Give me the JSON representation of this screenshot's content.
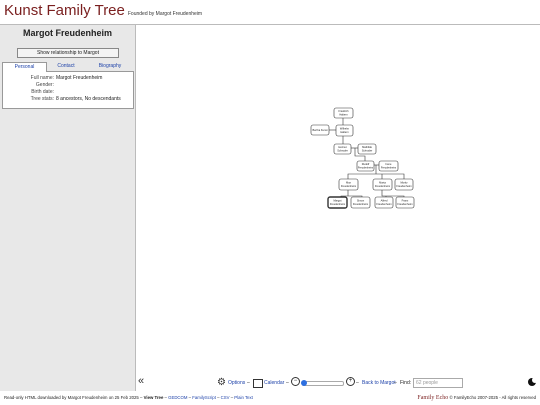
{
  "site": {
    "title": "Kunst Family Tree",
    "subtitle": "Founded by Margot Freudenheim",
    "brand_color": "#7a1f1f"
  },
  "sidebar": {
    "person_name": "Margot Freudenheim",
    "relationship_button": "Show relationship to Margot",
    "tabs": [
      "Personal",
      "Contact",
      "Biography"
    ],
    "active_tab": "Personal",
    "fields": [
      {
        "label": "Full name:",
        "value": "Margot Freudenheim"
      },
      {
        "label": "Gender:",
        "value": ""
      },
      {
        "label": "Birth date:",
        "value": ""
      },
      {
        "label": "Tree stats:",
        "value": "8 ancestors, No descendants"
      }
    ]
  },
  "tree": {
    "nodes": [
      {
        "id": "p1",
        "name": [
          "Friedrich",
          "Haltern"
        ]
      },
      {
        "id": "p2",
        "name": [
          "Bertha Kunst"
        ]
      },
      {
        "id": "p3",
        "name": [
          "Wilhelm",
          "Haltern"
        ]
      },
      {
        "id": "p4",
        "name": [
          "Helmut",
          "Schroder"
        ]
      },
      {
        "id": "p5",
        "name": [
          "Mathilde",
          "Schroder"
        ]
      },
      {
        "id": "p6",
        "name": [
          "Rudolf",
          "Freudenheim"
        ]
      },
      {
        "id": "p7",
        "name": [
          "Irene",
          "Freudenheim"
        ]
      },
      {
        "id": "p8",
        "name": [
          "Max",
          "Freudenheim"
        ]
      },
      {
        "id": "p9",
        "name": [
          "Marta",
          "Freudenheim"
        ]
      },
      {
        "id": "p10",
        "name": [
          "Moritz",
          "Freudenheim"
        ]
      },
      {
        "id": "p11",
        "name": [
          "Margot",
          "Freudenheim"
        ],
        "selected": true
      },
      {
        "id": "p12",
        "name": [
          "Simon",
          "Freudenheim"
        ]
      },
      {
        "id": "p13",
        "name": [
          "Alfred",
          "Freudenheim"
        ]
      },
      {
        "id": "p14",
        "name": [
          "Franz",
          "Freudenheim"
        ]
      }
    ]
  },
  "toolbar": {
    "options": "Options",
    "calendar": "Calendar",
    "back": "Back to Margot",
    "find_label": "Find:",
    "find_placeholder": "62 people",
    "zoom_level": 0.0,
    "accent_color": "#2d6fe0"
  },
  "footer": {
    "prefix": "Read-only HTML downloaded by Margot Freudenheim on 25 Feb 2025 –",
    "view_tree": "View Tree",
    "links": [
      "GEDCOM",
      "FamilyScript",
      "CSV",
      "Plain Text"
    ],
    "logo": "Family Echo",
    "copyright": "© FamilyEcho 2007-2025 - All rights reserved"
  }
}
